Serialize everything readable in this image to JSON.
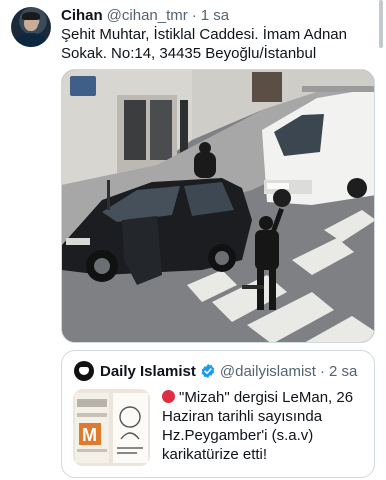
{
  "author": {
    "name": "Cihan",
    "handle": "@cihan_tmr",
    "separator": "·",
    "time": "1 sa"
  },
  "tweet": {
    "text": "Şehit Muhtar, İstiklal Caddesi. İmam Adnan Sokak. No:14, 34435 Beyoğlu/İstanbul"
  },
  "quoted": {
    "name": "Daily Islamist",
    "handle": "@dailyislamist",
    "separator": "·",
    "time": "2 sa",
    "text": "\"Mizah\" dergisi LeMan, 26 Haziran tarihli sayısında Hz.Peygamber'i (s.a.v) karikatürize etti!",
    "emoji": "red-circle-icon",
    "verified_icon": "verified-badge-icon"
  },
  "colors": {
    "text": "#0f1419",
    "secondary": "#536471",
    "border": "#cfd9de",
    "verified": "#1d9bf0",
    "red_circle": "#dd2e44"
  }
}
